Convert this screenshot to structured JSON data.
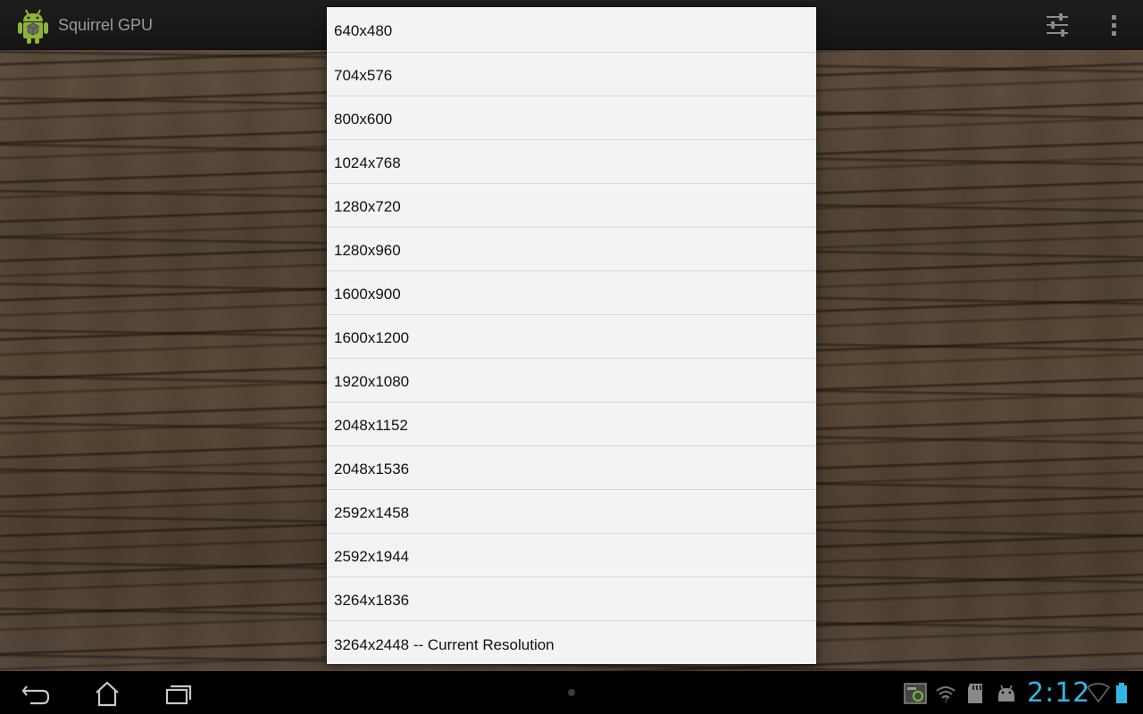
{
  "app": {
    "title": "Squirrel GPU",
    "logo_icon": "android-robot-icon"
  },
  "action_bar": {
    "settings_icon": "sliders-icon",
    "overflow_icon": "overflow-menu-icon"
  },
  "resolution_list": {
    "items": [
      {
        "label": "640x480"
      },
      {
        "label": "704x576"
      },
      {
        "label": "800x600"
      },
      {
        "label": "1024x768"
      },
      {
        "label": "1280x720"
      },
      {
        "label": "1280x960"
      },
      {
        "label": "1600x900"
      },
      {
        "label": "1600x1200"
      },
      {
        "label": "1920x1080"
      },
      {
        "label": "2048x1152"
      },
      {
        "label": "2048x1536"
      },
      {
        "label": "2592x1458"
      },
      {
        "label": "2592x1944"
      },
      {
        "label": "3264x1836"
      },
      {
        "label": "3264x2448 -- Current Resolution"
      }
    ]
  },
  "system_bar": {
    "clock": "2:12",
    "accent_color": "#33b5e5"
  }
}
